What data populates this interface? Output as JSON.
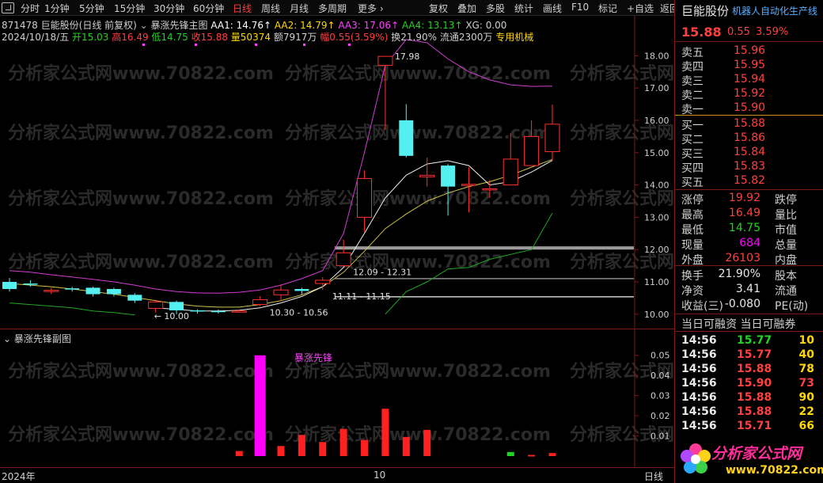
{
  "toolbar": {
    "left": [
      {
        "label": "分时",
        "active": false
      },
      {
        "label": "1分钟",
        "active": false
      },
      {
        "label": "5分钟",
        "active": false
      },
      {
        "label": "15分钟",
        "active": false
      },
      {
        "label": "30分钟",
        "active": false
      },
      {
        "label": "60分钟",
        "active": false
      },
      {
        "label": "日线",
        "active": true
      },
      {
        "label": "周线",
        "active": false
      },
      {
        "label": "月线",
        "active": false
      },
      {
        "label": "多周期",
        "active": false
      },
      {
        "label": "更多 ›",
        "active": false
      }
    ],
    "right": [
      "复权",
      "叠加",
      "多股",
      "统计",
      "画线",
      "F10",
      "标记",
      "+自选",
      "返回"
    ]
  },
  "header": {
    "code": "871478",
    "name_period": "巨能股份(日线 前复权)",
    "indicator_name": "暴涨先锋主图",
    "aa1": "AA1: 14.76↑",
    "aa2": "AA2: 14.79↑",
    "aa3": "AA3: 17.06↑",
    "aa4": "AA4: 13.13↑",
    "xg": "XG: 0.00",
    "date": "2024/10/18/五",
    "open": "开15.03",
    "high": "高16.49",
    "low": "低14.75",
    "close": "收15.88",
    "volume": "量50374",
    "amount": "额7917万",
    "change": "幅0.55(3.59%)",
    "turnover": "换21.90%",
    "float": "流通2300万",
    "industry": "专用机械"
  },
  "chart_data": [
    {
      "type": "candlestick",
      "title": "暴涨先锋主图",
      "ylim": [
        9.8,
        18.4
      ],
      "yticks": [
        10.0,
        11.0,
        12.0,
        13.0,
        14.0,
        15.0,
        16.0,
        17.0,
        18.0
      ],
      "candles": [
        {
          "o": 11.0,
          "c": 10.78,
          "h": 11.12,
          "l": 10.7
        },
        {
          "o": 10.95,
          "c": 10.92,
          "h": 11.05,
          "l": 10.85
        },
        {
          "o": 10.72,
          "c": 10.74,
          "h": 10.82,
          "l": 10.62
        },
        {
          "o": 10.8,
          "c": 10.78,
          "h": 10.85,
          "l": 10.7
        },
        {
          "o": 10.82,
          "c": 10.62,
          "h": 10.85,
          "l": 10.55
        },
        {
          "o": 10.78,
          "c": 10.62,
          "h": 10.82,
          "l": 10.55
        },
        {
          "o": 10.6,
          "c": 10.42,
          "h": 10.65,
          "l": 10.35
        },
        {
          "o": 10.18,
          "c": 10.38,
          "h": 10.45,
          "l": 10.05
        },
        {
          "o": 10.38,
          "c": 10.12,
          "h": 10.42,
          "l": 10.0
        },
        {
          "o": 10.12,
          "c": 10.1,
          "h": 10.15,
          "l": 10.02
        },
        {
          "o": 10.1,
          "c": 10.08,
          "h": 10.15,
          "l": 10.02
        },
        {
          "o": 10.08,
          "c": 10.1,
          "h": 10.15,
          "l": 10.05
        },
        {
          "o": 10.3,
          "c": 10.45,
          "h": 10.56,
          "l": 10.25
        },
        {
          "o": 10.6,
          "c": 10.75,
          "h": 10.92,
          "l": 10.4
        },
        {
          "o": 10.78,
          "c": 10.72,
          "h": 10.82,
          "l": 10.6
        },
        {
          "o": 10.95,
          "c": 11.05,
          "h": 11.15,
          "l": 10.75
        },
        {
          "o": 11.5,
          "c": 11.9,
          "h": 12.31,
          "l": 11.5
        },
        {
          "o": 13.0,
          "c": 14.2,
          "h": 14.45,
          "l": 12.55
        },
        {
          "o": 17.7,
          "c": 17.98,
          "h": 17.98,
          "l": 15.7
        },
        {
          "o": 16.0,
          "c": 14.9,
          "h": 16.5,
          "l": 14.85
        },
        {
          "o": 14.25,
          "c": 14.3,
          "h": 14.85,
          "l": 13.95
        },
        {
          "o": 14.6,
          "c": 13.95,
          "h": 14.65,
          "l": 13.05
        },
        {
          "o": 14.0,
          "c": 14.02,
          "h": 14.55,
          "l": 13.15
        },
        {
          "o": 13.85,
          "c": 13.88,
          "h": 14.15,
          "l": 13.6
        },
        {
          "o": 14.0,
          "c": 14.8,
          "h": 15.6,
          "l": 14.0
        },
        {
          "o": 14.6,
          "c": 15.5,
          "h": 16.0,
          "l": 14.6
        },
        {
          "o": 15.03,
          "c": 15.88,
          "h": 16.49,
          "l": 14.75
        }
      ],
      "lines": {
        "upper_magenta": [
          11.35,
          11.3,
          11.22,
          11.15,
          11.08,
          11.0,
          10.9,
          10.78,
          10.7,
          10.66,
          10.65,
          10.68,
          10.75,
          10.9,
          11.1,
          11.35,
          12.5,
          15.0,
          17.7,
          18.5,
          18.4,
          17.9,
          17.5,
          17.25,
          17.1,
          17.05,
          17.06
        ],
        "yellow": [
          10.95,
          10.9,
          10.85,
          10.78,
          10.7,
          10.62,
          10.52,
          10.42,
          10.32,
          10.25,
          10.22,
          10.22,
          10.3,
          10.42,
          10.6,
          10.85,
          11.3,
          11.95,
          12.65,
          13.1,
          13.5,
          13.75,
          13.95,
          14.1,
          14.3,
          14.55,
          14.79
        ],
        "white": [
          null,
          null,
          null,
          null,
          null,
          null,
          null,
          10.2,
          10.15,
          10.1,
          10.1,
          10.12,
          10.2,
          10.35,
          10.55,
          10.85,
          11.45,
          12.5,
          13.6,
          14.3,
          14.65,
          14.75,
          14.6,
          14.0,
          14.1,
          14.4,
          14.76
        ],
        "green": [
          10.35,
          10.3,
          10.25,
          10.2,
          10.1,
          10.05,
          9.98,
          null,
          null,
          null,
          null,
          null,
          null,
          null,
          null,
          null,
          null,
          null,
          10.0,
          10.7,
          11.0,
          11.4,
          11.45,
          11.7,
          11.85,
          12.0,
          13.13
        ]
      },
      "annotations": [
        {
          "text": "17.98",
          "idx": 18
        },
        {
          "text": "12.09 - 12.31",
          "idx": 16
        },
        {
          "text": "11.11 - 11.15",
          "idx": 15
        },
        {
          "text": "10.30 - 10.56",
          "idx": 12
        },
        {
          "text": "← 10.00",
          "idx": 7
        }
      ],
      "zones": [
        {
          "from": 12.0,
          "to": 12.1,
          "color": "#9a9a9a"
        },
        {
          "from": 11.1,
          "to": 11.12,
          "color": "#888888"
        },
        {
          "from": 10.52,
          "to": 10.56,
          "color": "#bbbbbb"
        }
      ]
    },
    {
      "type": "bar",
      "title": "暴涨先锋副图",
      "label": "暴涨先锋",
      "ylim": [
        0,
        0.055
      ],
      "yticks": [
        0.01,
        0.02,
        0.03,
        0.04,
        0.05
      ],
      "bars": [
        {
          "idx": 11,
          "v": 0.0025,
          "color": "#ff2020"
        },
        {
          "idx": 12,
          "v": 0.05,
          "color": "#ff00ff"
        },
        {
          "idx": 13,
          "v": 0.005,
          "color": "#ff2020"
        },
        {
          "idx": 14,
          "v": 0.0105,
          "color": "#ff2020"
        },
        {
          "idx": 15,
          "v": 0.007,
          "color": "#ff2020"
        },
        {
          "idx": 16,
          "v": 0.0135,
          "color": "#ff2020"
        },
        {
          "idx": 17,
          "v": 0.008,
          "color": "#ff2020"
        },
        {
          "idx": 18,
          "v": 0.0235,
          "color": "#ff2020"
        },
        {
          "idx": 19,
          "v": 0.0095,
          "color": "#ff2020"
        },
        {
          "idx": 20,
          "v": 0.013,
          "color": "#ff2020"
        },
        {
          "idx": 24,
          "v": 0.002,
          "color": "#21d421"
        },
        {
          "idx": 25,
          "v": 0.0006,
          "color": "#ff2020"
        },
        {
          "idx": 26,
          "v": 0.0015,
          "color": "#ff2020"
        }
      ]
    }
  ],
  "xaxis": {
    "year": "2024年",
    "month": "10",
    "tail": "日线"
  },
  "watermark": "分析家公式网www.70822.com",
  "panel": {
    "name": "巨能股份",
    "sector": "机器人自动化生产线",
    "price": "15.88",
    "change": "0.55",
    "pct": "3.59%",
    "asks": [
      {
        "label": "卖五",
        "price": "15.96"
      },
      {
        "label": "卖四",
        "price": "15.95"
      },
      {
        "label": "卖三",
        "price": "15.94"
      },
      {
        "label": "卖二",
        "price": "15.92"
      },
      {
        "label": "卖一",
        "price": "15.90"
      }
    ],
    "bids": [
      {
        "label": "买一",
        "price": "15.88"
      },
      {
        "label": "买二",
        "price": "15.86"
      },
      {
        "label": "买三",
        "price": "15.84"
      },
      {
        "label": "买四",
        "price": "15.83"
      },
      {
        "label": "买五",
        "price": "15.82"
      }
    ],
    "stats": [
      {
        "l1": "涨停",
        "v1": "19.92",
        "c1": "red",
        "l2": "跌停"
      },
      {
        "l1": "最高",
        "v1": "16.49",
        "c1": "red",
        "l2": "量比"
      },
      {
        "l1": "最低",
        "v1": "14.75",
        "c1": "green",
        "l2": "市值"
      },
      {
        "l1": "现量",
        "v1": "684",
        "c1": "magenta",
        "l2": "总量"
      },
      {
        "l1": "外盘",
        "v1": "26103",
        "c1": "red",
        "l2": "内盘"
      }
    ],
    "stats2": [
      {
        "l1": "换手",
        "v1": "21.90%",
        "l2": "股本"
      },
      {
        "l1": "净资",
        "v1": "3.41",
        "l2": "流通"
      },
      {
        "l1": "收益(三)",
        "v1": "-0.080",
        "l2": "PE(动)"
      }
    ],
    "margin_header": "当日可融资 当日可融券",
    "ticks": [
      {
        "time": "14:56",
        "price": "15.77",
        "pc": "green",
        "vol": "10",
        "vc": "yellow"
      },
      {
        "time": "14:56",
        "price": "15.77",
        "pc": "red",
        "vol": "40",
        "vc": "yellow"
      },
      {
        "time": "14:56",
        "price": "15.88",
        "pc": "red",
        "vol": "78",
        "vc": "yellow"
      },
      {
        "time": "14:56",
        "price": "15.90",
        "pc": "red",
        "vol": "73",
        "vc": "red"
      },
      {
        "time": "14:56",
        "price": "15.88",
        "pc": "red",
        "vol": "90",
        "vc": "yellow"
      },
      {
        "time": "14:56",
        "price": "15.88",
        "pc": "red",
        "vol": "22",
        "vc": "yellow"
      },
      {
        "time": "14:56",
        "price": "15.71",
        "pc": "red",
        "vol": "66",
        "vc": "yellow"
      }
    ],
    "logo_text": "分析家公式网",
    "logo_url": "www.70822.com"
  }
}
